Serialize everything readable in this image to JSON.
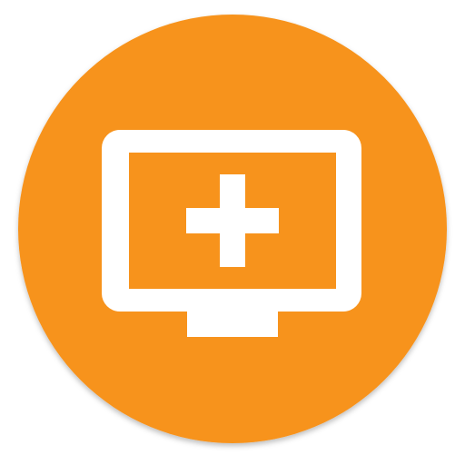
{
  "icon": {
    "name": "add-screen-icon",
    "shape": "circle",
    "background_color": "#F7931E",
    "foreground_color": "#FFFFFF",
    "glyph": "monitor-with-plus"
  }
}
